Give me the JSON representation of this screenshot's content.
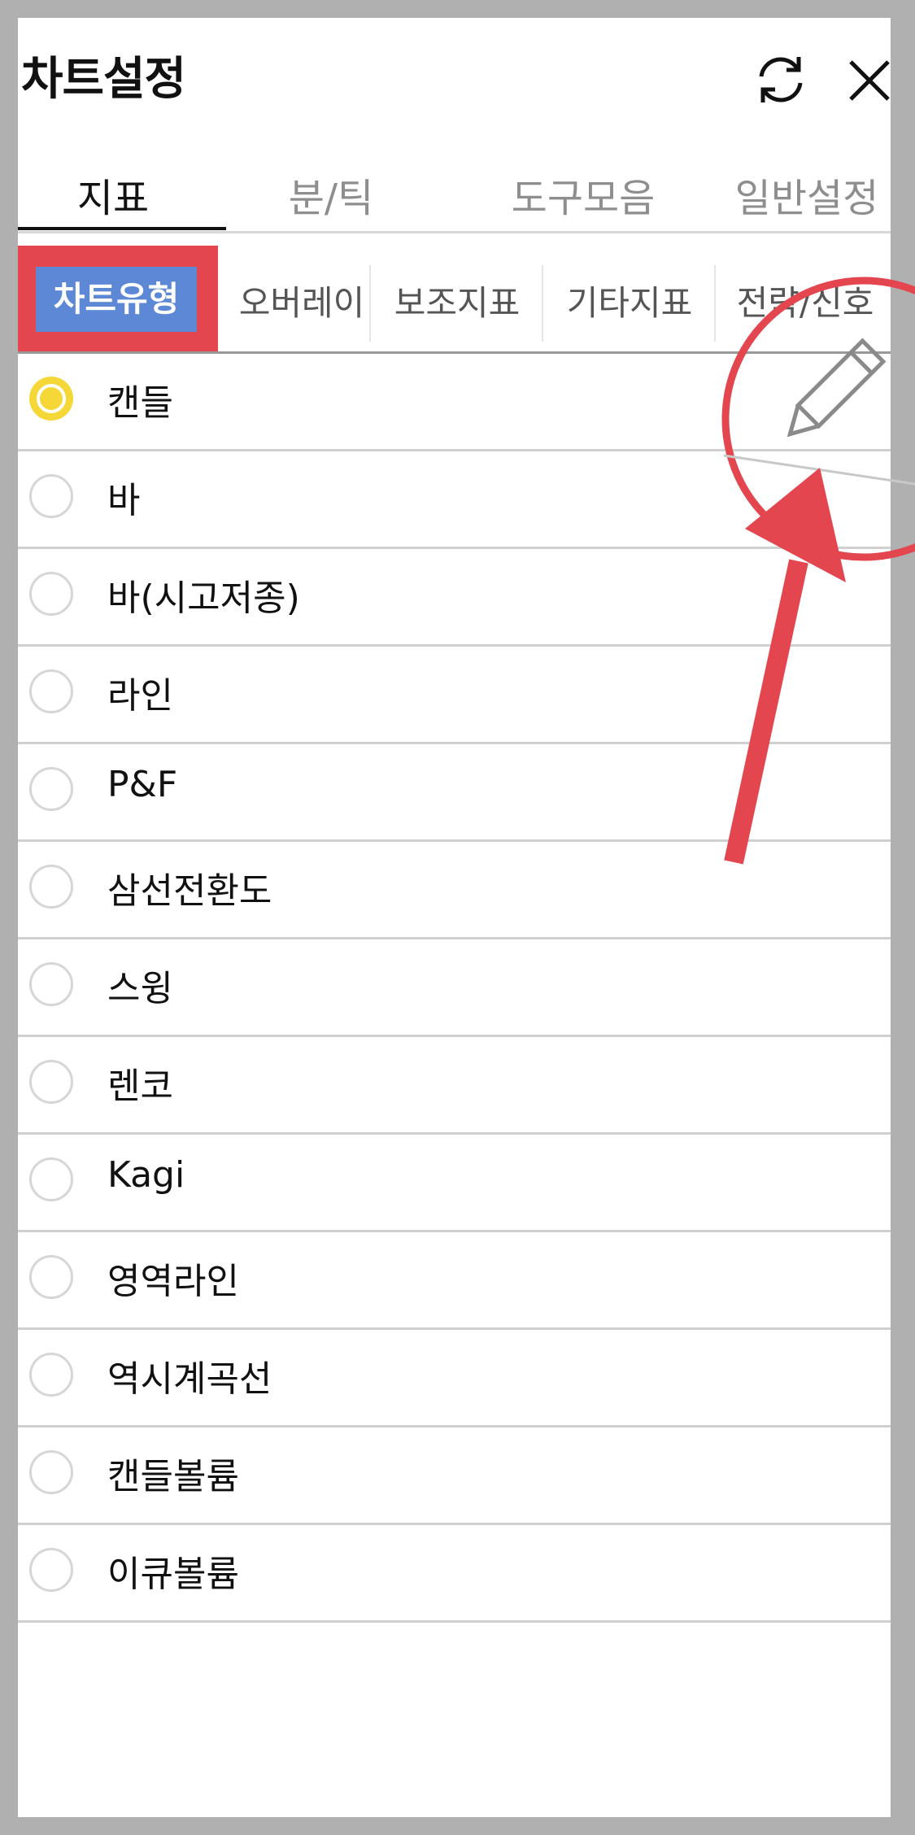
{
  "header": {
    "title": "차트설정"
  },
  "icons": {
    "refresh": "refresh-icon",
    "close": "close-icon",
    "pencil": "pencil-icon"
  },
  "tabs": [
    {
      "label": "지표",
      "active": true
    },
    {
      "label": "분/틱",
      "active": false
    },
    {
      "label": "도구모음",
      "active": false
    },
    {
      "label": "일반설정",
      "active": false
    }
  ],
  "subtabs": [
    {
      "label": "차트유형",
      "active": true
    },
    {
      "label": "오버레이",
      "active": false
    },
    {
      "label": "보조지표",
      "active": false
    },
    {
      "label": "기타지표",
      "active": false
    },
    {
      "label": "전략/신호",
      "active": false
    }
  ],
  "chart_types": [
    {
      "label": "캔들",
      "selected": true
    },
    {
      "label": "바",
      "selected": false
    },
    {
      "label": "바(시고저종)",
      "selected": false
    },
    {
      "label": "라인",
      "selected": false
    },
    {
      "label": "P&F",
      "selected": false
    },
    {
      "label": "삼선전환도",
      "selected": false
    },
    {
      "label": "스윙",
      "selected": false
    },
    {
      "label": "렌코",
      "selected": false
    },
    {
      "label": "Kagi",
      "selected": false
    },
    {
      "label": "영역라인",
      "selected": false
    },
    {
      "label": "역시계곡선",
      "selected": false
    },
    {
      "label": "캔들볼륨",
      "selected": false
    },
    {
      "label": "이큐볼륨",
      "selected": false
    }
  ],
  "colors": {
    "accent_red": "#e4464f",
    "active_blue": "#5c88d6",
    "radio_yellow": "#f5d838"
  }
}
